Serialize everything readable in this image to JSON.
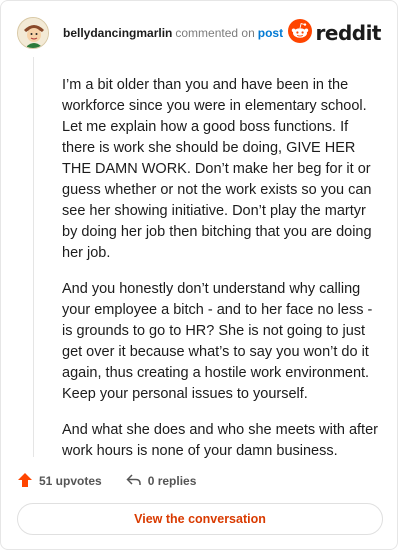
{
  "header": {
    "username": "bellydancingmarlin",
    "action": "commented on",
    "link": "post",
    "brand": "reddit",
    "avatar_icon": "cartoon-avatar-icon",
    "brand_icon": "reddit-snoo-icon"
  },
  "comment": {
    "paragraphs": [
      "I’m a bit older than you and have been in the workforce since you were in elementary school. Let me explain how a good boss functions. If there is work she should be doing, GIVE HER THE DAMN WORK. Don’t make her beg for it or guess whether or not the work exists so you can see her showing initiative. Don’t play the martyr by doing her job then bitching that you are doing her job.",
      "And you honestly don’t understand why calling your employee a bitch - and to her face no less - is grounds to go to HR? She is not going to just get over it because what’s to say you won’t do it again, thus creating a hostile work environment. Keep your personal issues to yourself.",
      "And what she does and who she meets with after work hours is none of your damn business."
    ]
  },
  "actions": {
    "upvotes": "51 upvotes",
    "replies": "0 replies",
    "upvote_color": "#ff4500"
  },
  "cta": {
    "label": "View the conversation",
    "color": "#d93a00"
  }
}
